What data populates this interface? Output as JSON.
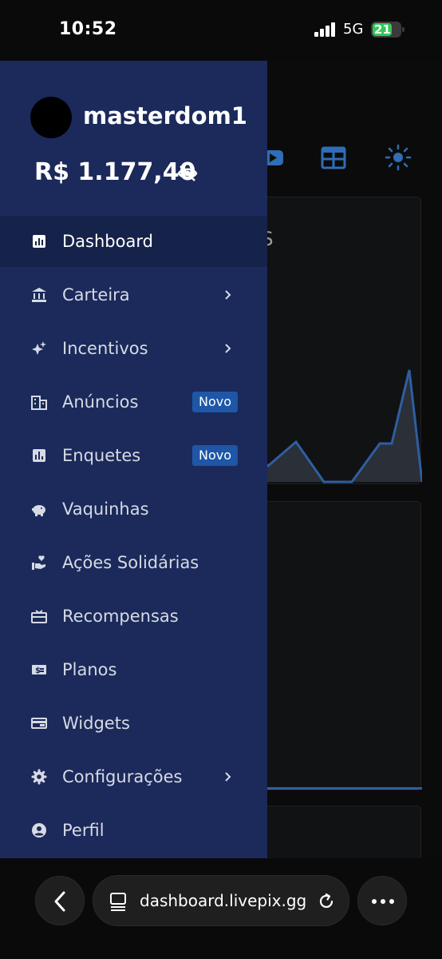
{
  "status_bar": {
    "time": "10:52",
    "network": "5G",
    "battery": "21"
  },
  "background": {
    "card_title": "AS",
    "icons": [
      "youtube-icon",
      "calendar-icon",
      "sun-icon"
    ]
  },
  "drawer": {
    "username": "masterdom1",
    "balance": "R$ 1.177,40",
    "items": [
      {
        "label": "Dashboard",
        "icon": "dashboard-icon",
        "active": true
      },
      {
        "label": "Carteira",
        "icon": "bank-icon",
        "chevron": true
      },
      {
        "label": "Incentivos",
        "icon": "sparkles-icon",
        "chevron": true
      },
      {
        "label": "Anúncios",
        "icon": "building-icon",
        "badge": "Novo"
      },
      {
        "label": "Enquetes",
        "icon": "poll-icon",
        "badge": "Novo"
      },
      {
        "label": "Vaquinhas",
        "icon": "piggy-bank-icon"
      },
      {
        "label": "Ações Solidárias",
        "icon": "volunteer-icon"
      },
      {
        "label": "Recompensas",
        "icon": "gift-card-icon"
      },
      {
        "label": "Planos",
        "icon": "money-icon"
      },
      {
        "label": "Widgets",
        "icon": "widget-icon"
      },
      {
        "label": "Configurações",
        "icon": "gear-icon",
        "chevron": true
      },
      {
        "label": "Perfil",
        "icon": "account-icon"
      }
    ]
  },
  "browser": {
    "url": "dashboard.livepix.gg"
  },
  "colors": {
    "drawer_bg": "#1b2a5b",
    "active_item_bg": "#15224a",
    "badge_bg": "#1e56a8",
    "accent": "#2f6db5"
  }
}
